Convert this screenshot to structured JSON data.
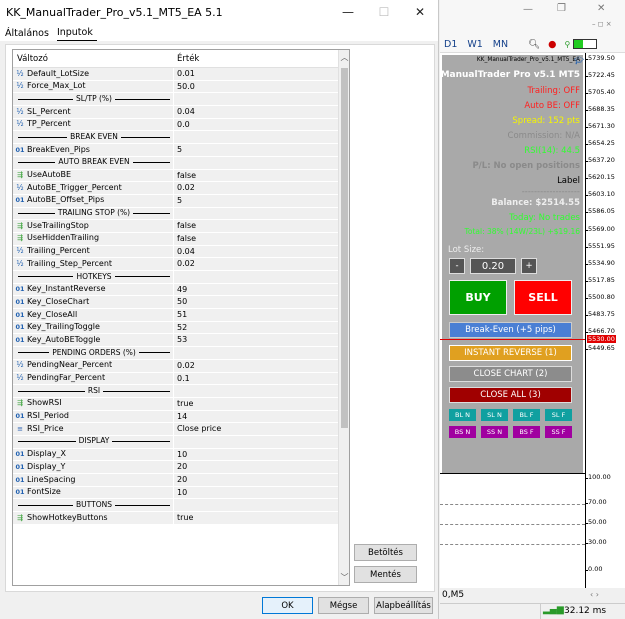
{
  "dialog": {
    "title": "KK_ManualTrader_Pro_v5.1_MT5_EA 5.1",
    "tabs": [
      "Általános",
      "Inputok"
    ],
    "grid_headers": {
      "variable": "Változó",
      "value": "Érték"
    },
    "rows": [
      {
        "type": "frac",
        "name": "Default_LotSize",
        "value": "0.01"
      },
      {
        "type": "frac",
        "name": "Force_Max_Lot",
        "value": "50.0"
      },
      {
        "type": "sep",
        "name": "SL/TP (%)",
        "value": ""
      },
      {
        "type": "frac",
        "name": "SL_Percent",
        "value": "0.04"
      },
      {
        "type": "frac",
        "name": "TP_Percent",
        "value": "0.0"
      },
      {
        "type": "sep",
        "name": "BREAK EVEN",
        "value": ""
      },
      {
        "type": "num",
        "name": "BreakEven_Pips",
        "value": "5"
      },
      {
        "type": "sep",
        "name": "AUTO BREAK EVEN",
        "value": ""
      },
      {
        "type": "bool",
        "name": "UseAutoBE",
        "value": "false"
      },
      {
        "type": "frac",
        "name": "AutoBE_Trigger_Percent",
        "value": "0.02"
      },
      {
        "type": "num",
        "name": "AutoBE_Offset_Pips",
        "value": "5"
      },
      {
        "type": "sep",
        "name": "TRAILING STOP (%)",
        "value": ""
      },
      {
        "type": "bool",
        "name": "UseTrailingStop",
        "value": "false"
      },
      {
        "type": "bool",
        "name": "UseHiddenTrailing",
        "value": "false"
      },
      {
        "type": "frac",
        "name": "Trailing_Percent",
        "value": "0.04"
      },
      {
        "type": "frac",
        "name": "Trailing_Step_Percent",
        "value": "0.02"
      },
      {
        "type": "sep",
        "name": "HOTKEYS",
        "value": ""
      },
      {
        "type": "num",
        "name": "Key_InstantReverse",
        "value": "49"
      },
      {
        "type": "num",
        "name": "Key_CloseChart",
        "value": "50"
      },
      {
        "type": "num",
        "name": "Key_CloseAll",
        "value": "51"
      },
      {
        "type": "num",
        "name": "Key_TrailingToggle",
        "value": "52"
      },
      {
        "type": "num",
        "name": "Key_AutoBEToggle",
        "value": "53"
      },
      {
        "type": "sep",
        "name": "PENDING ORDERS (%)",
        "value": ""
      },
      {
        "type": "frac",
        "name": "PendingNear_Percent",
        "value": "0.02"
      },
      {
        "type": "frac",
        "name": "PendingFar_Percent",
        "value": "0.1"
      },
      {
        "type": "sep",
        "name": "RSI",
        "value": ""
      },
      {
        "type": "bool",
        "name": "ShowRSI",
        "value": "true"
      },
      {
        "type": "num",
        "name": "RSI_Period",
        "value": "14"
      },
      {
        "type": "list",
        "name": "RSI_Price",
        "value": "Close price"
      },
      {
        "type": "sep",
        "name": "DISPLAY",
        "value": ""
      },
      {
        "type": "num",
        "name": "Display_X",
        "value": "10"
      },
      {
        "type": "num",
        "name": "Display_Y",
        "value": "20"
      },
      {
        "type": "num",
        "name": "LineSpacing",
        "value": "20"
      },
      {
        "type": "num",
        "name": "FontSize",
        "value": "10"
      },
      {
        "type": "sep",
        "name": "BUTTONS",
        "value": ""
      },
      {
        "type": "bool",
        "name": "ShowHotkeyButtons",
        "value": "true"
      }
    ],
    "buttons": {
      "load": "Betöltés",
      "save": "Mentés",
      "ok": "OK",
      "cancel": "Mégse",
      "defaults": "Alapbeállítás"
    }
  },
  "mt5": {
    "timeframes": [
      "D1",
      "W1",
      "MN"
    ],
    "symbol_tab": "0,M5",
    "ping": "32.12 ms",
    "panel": {
      "ea_name": "KK_ManualTrader_Pro_v5.1_MT5_EA",
      "title": "ManualTrader Pro v5.1 MT5",
      "trailing": "Trailing: OFF",
      "auto_be": "Auto BE: OFF",
      "spread": "Spread: 152 pts",
      "commission": "Commission: N/A",
      "rsi": "RSI(14): 44.5",
      "pl": "P/L: No open positions",
      "label": "Label",
      "dashes": "-------------------",
      "balance": "Balance: $2514.55",
      "today": "Today: No trades",
      "total": "Total: 38% (14W/23L) +$19.16",
      "lot_label": "Lot Size:",
      "lot_minus": "-",
      "lot_value": "0.20",
      "lot_plus": "+",
      "buy": "BUY",
      "sell": "SELL",
      "break_even": "Break-Even (+5 pips)",
      "instant_reverse": "INSTANT REVERSE (1)",
      "close_chart": "CLOSE CHART (2)",
      "close_all": "CLOSE ALL (3)",
      "small_row1": [
        "BL N",
        "SL N",
        "BL F",
        "SL F"
      ],
      "small_row2": [
        "BS N",
        "SS N",
        "BS F",
        "SS F"
      ]
    },
    "price_ticks": [
      "5739.50",
      "5722.45",
      "5705.40",
      "5688.35",
      "5671.30",
      "5654.25",
      "5637.20",
      "5620.15",
      "5603.10",
      "5586.05",
      "5569.00",
      "5551.95",
      "5534.90",
      "5517.85",
      "5500.80",
      "5483.75",
      "5466.70",
      "5449.65"
    ],
    "current_price": "5530.00",
    "rsi_ticks": [
      "100.00",
      "70.00",
      "50.00",
      "30.00",
      "0.00"
    ],
    "colors": {
      "panel_bg": "#a9a9a9",
      "trailing": "#ff2020",
      "auto_be": "#ff2020",
      "spread": "#f5f500",
      "rsi": "#30ff30",
      "balance": "#eeeeee",
      "total": "#30ff30",
      "buy": "#00a000",
      "sell": "#ff0000",
      "break_even": "#4a7fd4",
      "instant_reverse": "#e0a020",
      "close_chart": "#8c8c8c",
      "close_all": "#a00000",
      "teal": "#10a0a0",
      "purple": "#a000a0"
    }
  }
}
